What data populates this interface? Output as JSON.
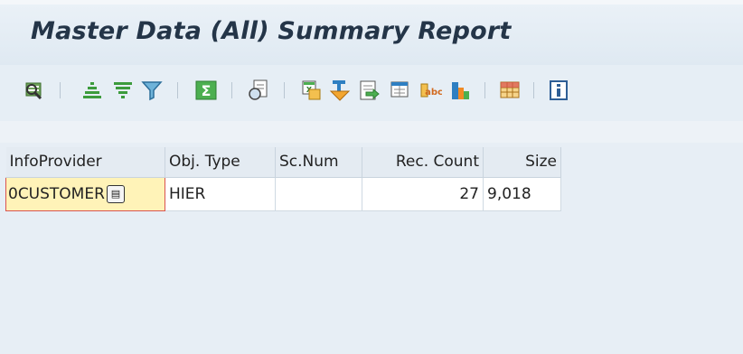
{
  "header": {
    "title": "Master Data (All) Summary Report"
  },
  "toolbar": {
    "buttons": [
      {
        "icon": "details-icon",
        "name": "details-button"
      },
      {
        "icon": "sort-ascending-icon",
        "name": "sort-ascending-button"
      },
      {
        "icon": "sort-descending-icon",
        "name": "sort-descending-button"
      },
      {
        "icon": "filter-icon",
        "name": "filter-button"
      },
      {
        "icon": "sum-icon",
        "name": "total-button"
      },
      {
        "icon": "print-preview-icon",
        "name": "print-preview-button"
      },
      {
        "icon": "export-spreadsheet-icon",
        "name": "export-spreadsheet-button"
      },
      {
        "icon": "word-processing-icon",
        "name": "word-processing-button"
      },
      {
        "icon": "local-file-icon",
        "name": "local-file-button"
      },
      {
        "icon": "abc-analysis-icon",
        "name": "abc-analysis-button"
      },
      {
        "icon": "graphic-icon",
        "name": "graphic-button"
      },
      {
        "icon": "chart-icon",
        "name": "chart-button"
      },
      {
        "icon": "layout-icon",
        "name": "change-layout-button"
      },
      {
        "icon": "info-icon",
        "name": "info-button"
      }
    ]
  },
  "table": {
    "columns": [
      "InfoProvider",
      "Obj. Type",
      "Sc.Num",
      "Rec. Count",
      "Size"
    ],
    "rows": [
      {
        "infoprovider": "0CUSTOMER",
        "obj_type": "HIER",
        "sc_num": "",
        "rec_count": "27",
        "size": "9,018"
      }
    ]
  },
  "colors": {
    "selection_fill": "#fff3b8",
    "selection_border": "#d9534f",
    "title_text": "#243548"
  }
}
